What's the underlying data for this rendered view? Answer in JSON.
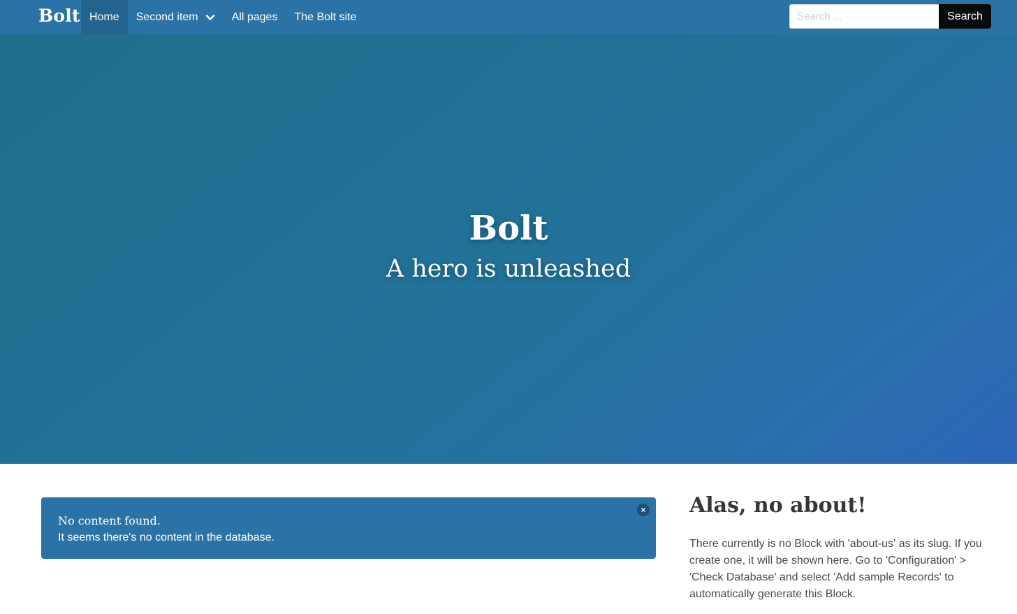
{
  "navbar": {
    "brand": "Bolt",
    "items": [
      {
        "label": "Home",
        "active": true
      },
      {
        "label": "Second item",
        "has_dropdown": true
      },
      {
        "label": "All pages"
      },
      {
        "label": "The Bolt site"
      }
    ],
    "search": {
      "placeholder": "Search ...",
      "button_label": "Search"
    }
  },
  "hero": {
    "title": "Bolt",
    "subtitle": "A hero is unleashed"
  },
  "notification": {
    "title": "No content found.",
    "text": "It seems there's no content in the database."
  },
  "about": {
    "title": "Alas, no about!",
    "text": "There currently is no Block with 'about-us' as its slug. If you create one, it will be shown here. Go to 'Configuration' > 'Check Database' and select 'Add sample Records' to automatically generate this Block."
  },
  "colors": {
    "navbar": "#2b73a6",
    "hero_start": "#1f6e8c",
    "hero_end": "#2b65b8",
    "search_button": "#0a0a0a"
  }
}
